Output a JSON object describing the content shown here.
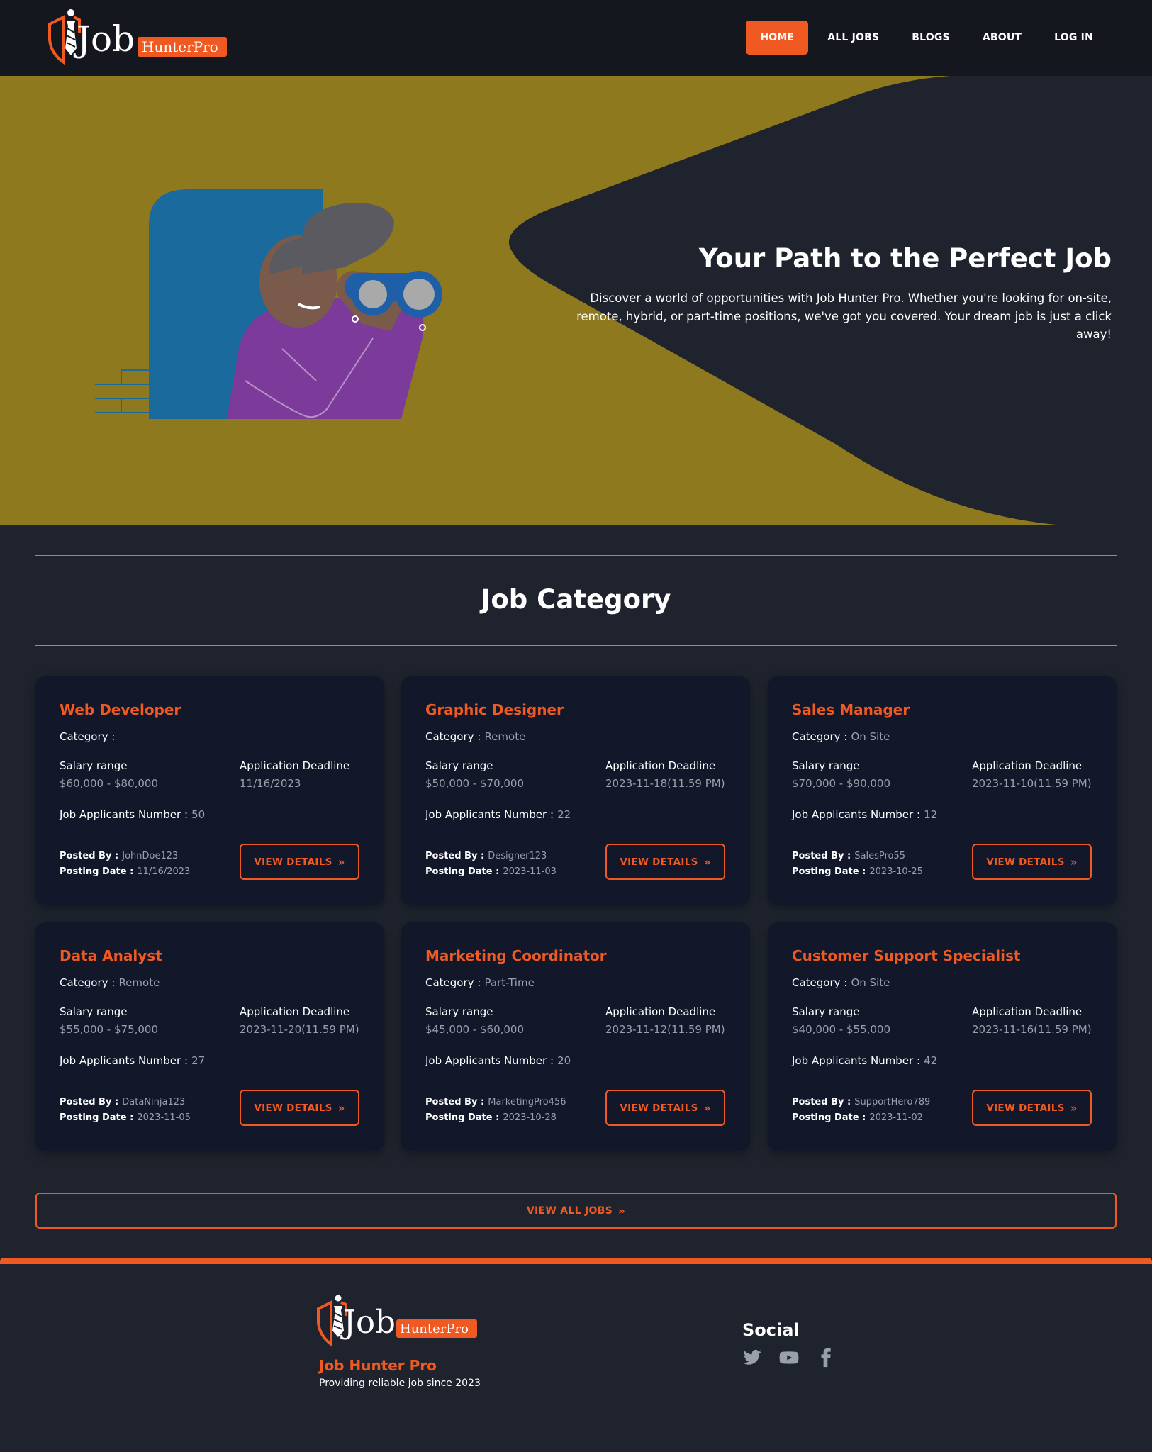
{
  "brand": {
    "logo_word": "Job",
    "logo_tag": "HunterPro"
  },
  "nav": [
    {
      "label": "HOME",
      "active": true
    },
    {
      "label": "ALL JOBS"
    },
    {
      "label": "BLOGS"
    },
    {
      "label": "ABOUT"
    },
    {
      "label": "LOG IN"
    }
  ],
  "hero": {
    "title": "Your Path to the Perfect Job",
    "text": "Discover a world of opportunities with Job Hunter Pro. Whether you're looking for on-site, remote, hybrid, or part-time positions, we've got you covered. Your dream job is just a click away!"
  },
  "section": {
    "title": "Job Category"
  },
  "labels": {
    "category": "Category :",
    "salary": "Salary range",
    "deadline": "Application Deadline",
    "applicants": "Job Applicants Number :",
    "posted_by": "Posted By :",
    "posting_date": "Posting Date :",
    "view_details": "VIEW DETAILS",
    "view_all": "VIEW ALL JOBS"
  },
  "jobs": [
    {
      "title": "Web Developer",
      "category": "",
      "salary": "$60,000 - $80,000",
      "deadline": "11/16/2023",
      "applicants": "50",
      "posted_by": "JohnDoe123",
      "posting_date": "11/16/2023"
    },
    {
      "title": "Graphic Designer",
      "category": "Remote",
      "salary": "$50,000 - $70,000",
      "deadline": "2023-11-18(11.59 PM)",
      "applicants": "22",
      "posted_by": "Designer123",
      "posting_date": "2023-11-03"
    },
    {
      "title": "Sales Manager",
      "category": "On Site",
      "salary": "$70,000 - $90,000",
      "deadline": "2023-11-10(11.59 PM)",
      "applicants": "12",
      "posted_by": "SalesPro55",
      "posting_date": "2023-10-25"
    },
    {
      "title": "Data Analyst",
      "category": "Remote",
      "salary": "$55,000 - $75,000",
      "deadline": "2023-11-20(11.59 PM)",
      "applicants": "27",
      "posted_by": "DataNinja123",
      "posting_date": "2023-11-05"
    },
    {
      "title": "Marketing Coordinator",
      "category": "Part-Time",
      "salary": "$45,000 - $60,000",
      "deadline": "2023-11-12(11.59 PM)",
      "applicants": "20",
      "posted_by": "MarketingPro456",
      "posting_date": "2023-10-28"
    },
    {
      "title": "Customer Support Specialist",
      "category": "On Site",
      "salary": "$40,000 - $55,000",
      "deadline": "2023-11-16(11.59 PM)",
      "applicants": "42",
      "posted_by": "SupportHero789",
      "posting_date": "2023-11-02"
    }
  ],
  "footer": {
    "brand": "Job Hunter Pro",
    "tagline": "Providing reliable job since 2023",
    "social_title": "Social",
    "social_icons": [
      "twitter-icon",
      "youtube-icon",
      "facebook-icon"
    ]
  },
  "colors": {
    "accent": "#f05a22",
    "hero_bg": "#8f791e",
    "page_bg": "#1e232d",
    "card_bg": "#12172a",
    "nav_bg": "#14171d"
  }
}
